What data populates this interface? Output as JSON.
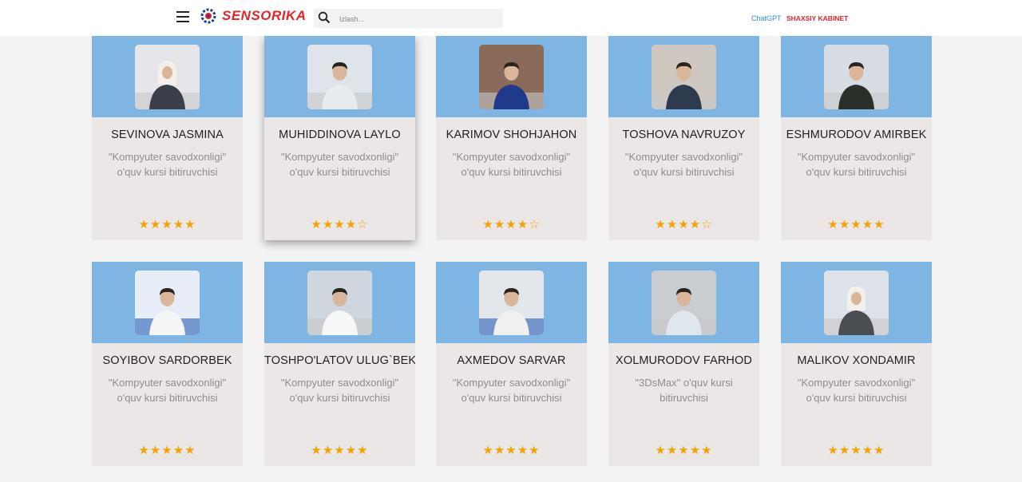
{
  "header": {
    "logo_text": "SENSORIKA",
    "search_placeholder": "Izlash...",
    "chatgpt_label": "ChatGPT",
    "cabinet_label": "SHAXSIY KABINET",
    "brand_color": "#e3242b",
    "link_color": "#2f8fd8"
  },
  "cards": [
    {
      "name": "SEVINOVA JASMINA",
      "desc1": "\"Kompyuter savodxonligi\"",
      "desc2": "o'quv kursi bitiruvchisi",
      "rating": 5
    },
    {
      "name": "MUHIDDINOVA LAYLO",
      "desc1": "\"Kompyuter savodxonligi\"",
      "desc2": "o'quv kursi bitiruvchisi",
      "rating": 4
    },
    {
      "name": "KARIMOV SHOHJAHON",
      "desc1": "\"Kompyuter savodxonligi\"",
      "desc2": "o'quv kursi bitiruvchisi",
      "rating": 4
    },
    {
      "name": "TOSHOVA NAVRUZOY",
      "desc1": "\"Kompyuter savodxonligi\"",
      "desc2": "o'quv kursi bitiruvchisi",
      "rating": 4
    },
    {
      "name": "ESHMURODOV AMIRBEK",
      "desc1": "\"Kompyuter savodxonligi\"",
      "desc2": "o'quv kursi bitiruvchisi",
      "rating": 5
    },
    {
      "name": "SOYIBOV SARDORBEK",
      "desc1": "\"Kompyuter savodxonligi\"",
      "desc2": "o'quv kursi bitiruvchisi",
      "rating": 5
    },
    {
      "name": "TOSHPO'LATOV ULUG`BEK",
      "desc1": "\"Kompyuter savodxonligi\"",
      "desc2": "o'quv kursi bitiruvchisi",
      "rating": 5
    },
    {
      "name": "AXMEDOV SARVAR",
      "desc1": "\"Kompyuter savodxonligi\"",
      "desc2": "o'quv kursi bitiruvchisi",
      "rating": 5
    },
    {
      "name": "XOLMURODOV FARHOD",
      "desc1": "\"3DsMax\" o'quv kursi",
      "desc2": "bitiruvchisi",
      "rating": 5
    },
    {
      "name": "MALIKOV XONDAMIR",
      "desc1": "\"Kompyuter savodxonligi\"",
      "desc2": "o'quv kursi bitiruvchisi",
      "rating": 5
    }
  ],
  "colors": {
    "card_top": "#7fb5e3",
    "card_body": "#ebe7e6",
    "star": "#f5a300",
    "page_bg": "#f3f3f3"
  }
}
